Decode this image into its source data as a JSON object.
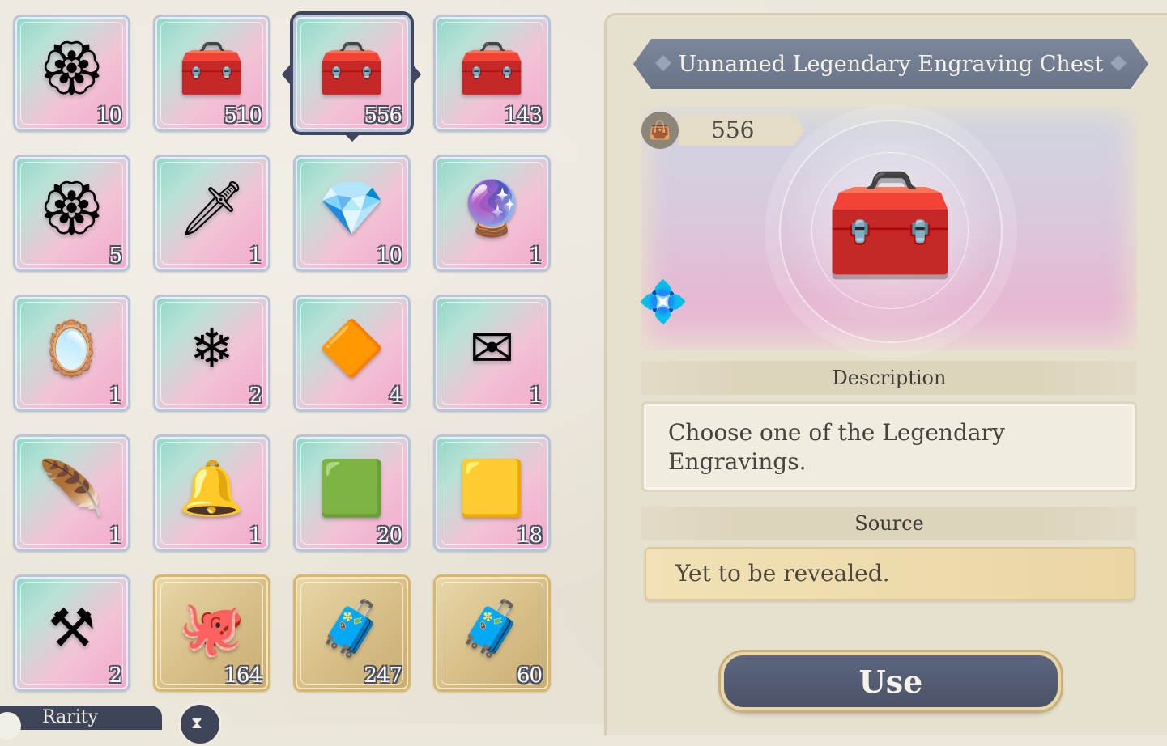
{
  "inventory": {
    "items": [
      {
        "icon": "ornament-charm-icon",
        "glyph": "🏵",
        "count": "10",
        "rarity": "rainbow"
      },
      {
        "icon": "treasure-chest-icon",
        "glyph": "🧰",
        "count": "510",
        "rarity": "rainbow"
      },
      {
        "icon": "treasure-chest-icon",
        "glyph": "🧰",
        "count": "556",
        "rarity": "rainbow",
        "selected": true
      },
      {
        "icon": "treasure-chest-icon",
        "glyph": "🧰",
        "count": "143",
        "rarity": "rainbow"
      },
      {
        "icon": "ornament-charm-icon",
        "glyph": "🏵",
        "count": "5",
        "rarity": "rainbow"
      },
      {
        "icon": "crystal-dagger-icon",
        "glyph": "🗡",
        "count": "1",
        "rarity": "rainbow"
      },
      {
        "icon": "gem-box-icon",
        "glyph": "💎",
        "count": "10",
        "rarity": "rainbow"
      },
      {
        "icon": "golden-orb-icon",
        "glyph": "🔮",
        "count": "1",
        "rarity": "rainbow"
      },
      {
        "icon": "magic-mirror-icon",
        "glyph": "🪞",
        "count": "1",
        "rarity": "rainbow"
      },
      {
        "icon": "crystal-flower-icon",
        "glyph": "❄",
        "count": "2",
        "rarity": "rainbow"
      },
      {
        "icon": "laurel-crystal-icon",
        "glyph": "🔶",
        "count": "4",
        "rarity": "rainbow"
      },
      {
        "icon": "sealed-letter-icon",
        "glyph": "✉",
        "count": "1",
        "rarity": "rainbow"
      },
      {
        "icon": "feather-quill-icon",
        "glyph": "🪶",
        "count": "1",
        "rarity": "rainbow"
      },
      {
        "icon": "golden-bell-icon",
        "glyph": "🔔",
        "count": "1",
        "rarity": "rainbow"
      },
      {
        "icon": "green-gem-cube-icon",
        "glyph": "🟩",
        "count": "20",
        "rarity": "rainbow"
      },
      {
        "icon": "gold-gem-cube-icon",
        "glyph": "🟨",
        "count": "18",
        "rarity": "rainbow"
      },
      {
        "icon": "anvil-icon",
        "glyph": "⚒",
        "count": "2",
        "rarity": "rainbow"
      },
      {
        "icon": "octopus-dish-icon",
        "glyph": "🐙",
        "count": "164",
        "rarity": "gold"
      },
      {
        "icon": "silver-chest-icon",
        "glyph": "🧳",
        "count": "247",
        "rarity": "gold"
      },
      {
        "icon": "silver-chest-icon",
        "glyph": "🧳",
        "count": "60",
        "rarity": "gold"
      }
    ],
    "filter_label": "Rarity"
  },
  "detail": {
    "title": "Unnamed Legendary Engraving Chest",
    "quantity": "556",
    "description_header": "Description",
    "description": "Choose one of the Legendary Engravings.",
    "source_header": "Source",
    "source": "Yet to be revealed.",
    "use_label": "Use"
  }
}
